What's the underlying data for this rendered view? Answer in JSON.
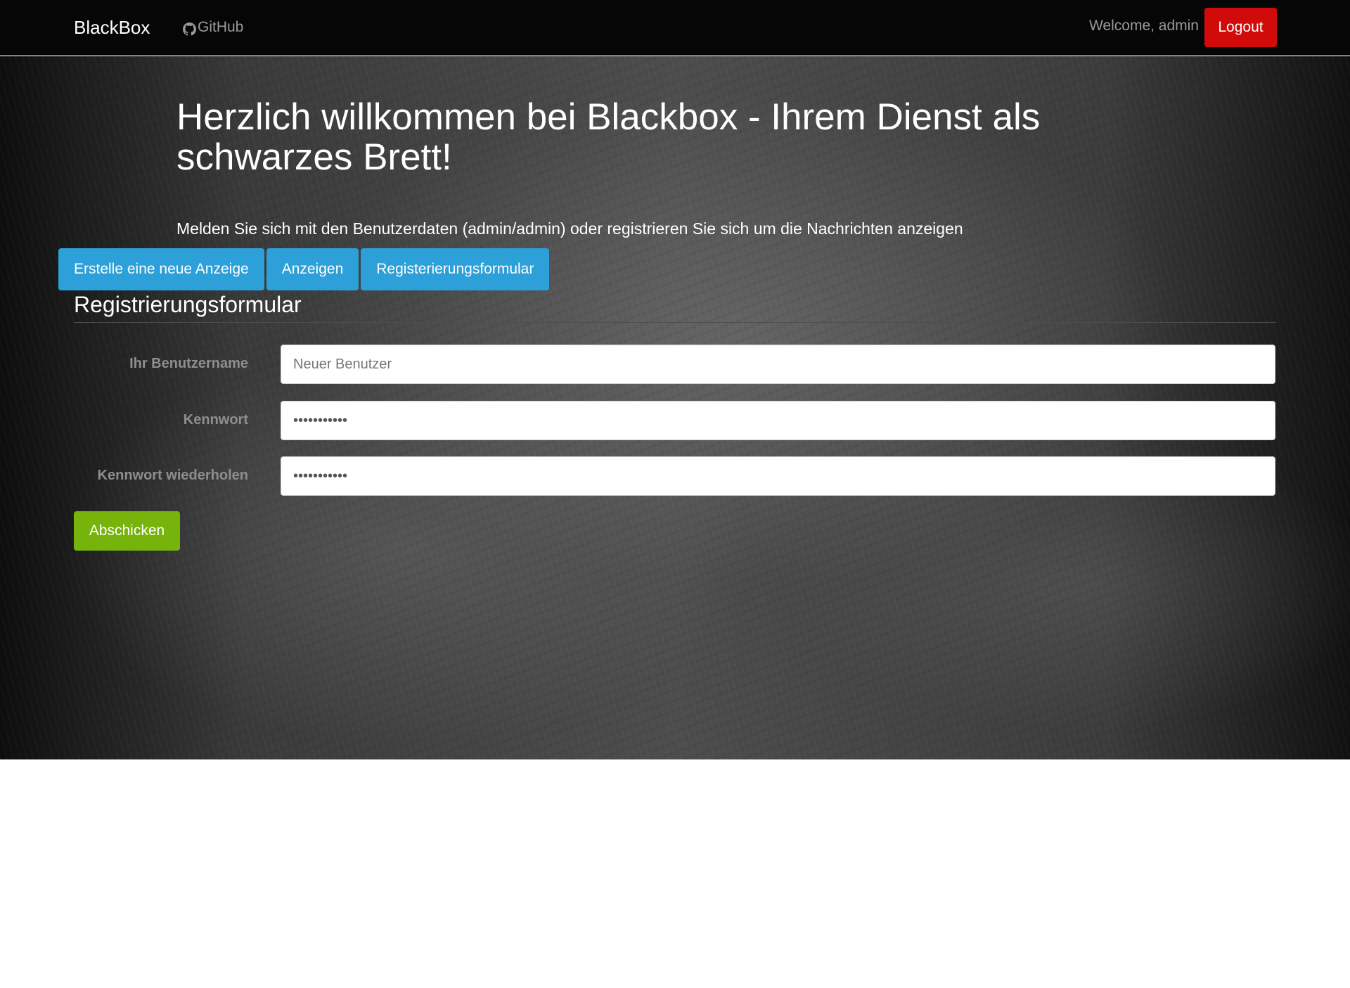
{
  "navbar": {
    "brand": "BlackBox",
    "github_label": "GitHub",
    "github_icon": "github-icon",
    "welcome_text": "Welcome, admin",
    "logout_label": "Logout",
    "logout_color": "#d10a0a"
  },
  "hero": {
    "headline": "Herzlich willkommen bei Blackbox - Ihrem Dienst als schwarzes Brett!",
    "lead": "Melden Sie sich mit den Benutzerdaten (admin/admin) oder registrieren Sie sich um die Nachrichten anzeigen"
  },
  "tabs": [
    {
      "label": "Erstelle eine neue Anzeige"
    },
    {
      "label": "Anzeigen"
    },
    {
      "label": "Registerierungsformular"
    }
  ],
  "tab_color": "#2d9fd9",
  "form": {
    "title": "Registrierungsformular",
    "username": {
      "label": "Ihr Benutzername",
      "placeholder": "Neuer Benutzer",
      "value": ""
    },
    "password": {
      "label": "Kennwort",
      "value": "•••••••••••"
    },
    "password_repeat": {
      "label": "Kennwort wiederholen",
      "value": "•••••••••••"
    },
    "submit_label": "Abschicken",
    "submit_color": "#77b40b"
  }
}
